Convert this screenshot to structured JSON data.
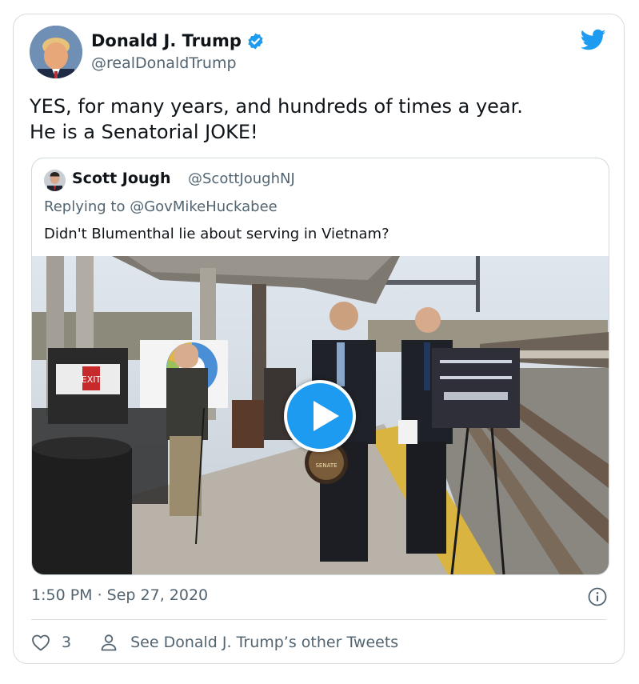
{
  "author": {
    "name": "Donald J. Trump",
    "handle": "@realDonaldTrump",
    "verified": true
  },
  "tweet": {
    "text": "YES, for many years, and hundreds of times a year.\nHe is a Senatorial JOKE!",
    "timestamp": "1:50 PM · Sep 27, 2020"
  },
  "quoted_tweet": {
    "name": "Scott Jough",
    "handle": "@ScottJoughNJ",
    "replying_to": "Replying to @GovMikeHuckabee",
    "text": "Didn't Blumenthal lie about serving in Vietnam?",
    "video_signs": {
      "exit_sign": "EXIT",
      "seal_text": "SENATE"
    }
  },
  "actions": {
    "like_count": "3",
    "other_tweets": "See Donald J. Trump’s other Tweets"
  },
  "colors": {
    "accent": "#1d9bf0",
    "secondary_text": "#536471",
    "primary_text": "#0f1419",
    "border": "#d6dbe0"
  },
  "icons": [
    "twitter-bird-icon",
    "verified-badge-icon",
    "play-icon",
    "info-icon",
    "heart-icon",
    "person-icon"
  ]
}
